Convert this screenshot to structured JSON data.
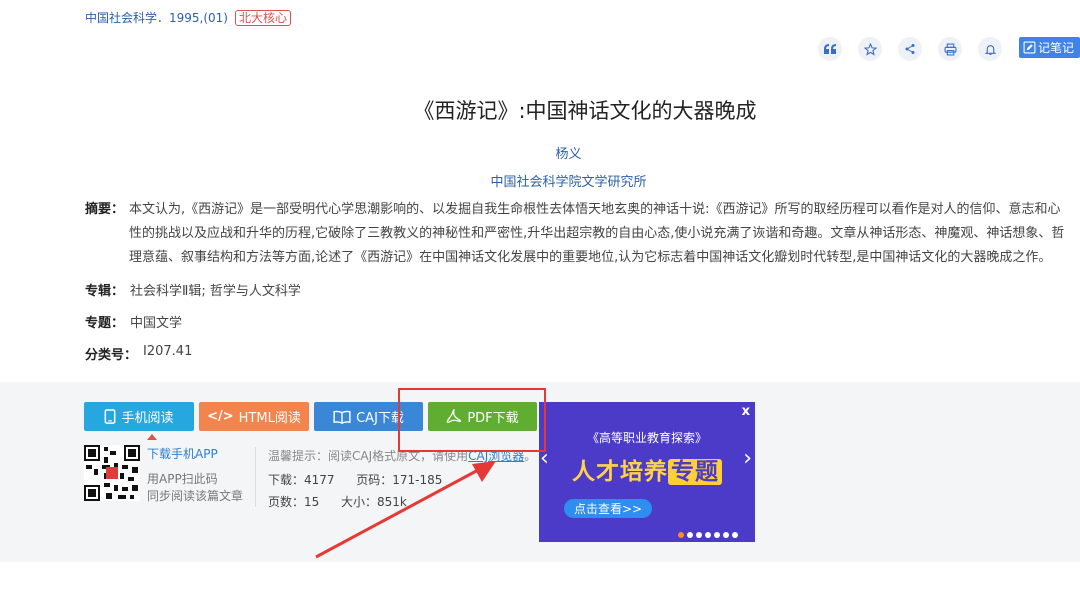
{
  "source": {
    "journal": "中国社会科学．1995,(01)",
    "badge": "北大核心"
  },
  "toolbar": {
    "icons": [
      "quote-icon",
      "star-icon",
      "share-icon",
      "print-icon",
      "bell-icon"
    ],
    "note_label": "记笔记"
  },
  "article": {
    "title": "《西游记》:中国神话文化的大器晚成",
    "author": "杨义",
    "organization": "中国社会科学院文学研究所",
    "abstract_label": "摘要：",
    "abstract_lines": [
      "本文认为,《西游记》是一部受明代心学思潮影响的、以发掘自我生命根性去体悟天地玄奥的神话十说:《西游记》所写的取经历程可以看作是对人的信仰、意志和心",
      "性的挑战以及应战和升华的历程,它破除了三教教义的神秘性和严密性,升华出超宗教的自由心态,使小说充满了诙谐和奇趣。文章从神话形态、神魔观、神话想象、哲",
      "理意蕴、叙事结构和方法等方面,论述了《西游记》在中国神话文化发展中的重要地位,认为它标志着中国神话文化瓣划时代转型,是中国神话文化的大器晚成之作。"
    ],
    "series_label": "专辑：",
    "series_value": "社会科学Ⅱ辑; 哲学与人文科学",
    "topic_label": "专题：",
    "topic_value": "中国文学",
    "class_label": "分类号：",
    "class_value": "I207.41"
  },
  "downloads": {
    "mobile": "手机阅读",
    "html": "HTML阅读",
    "caj": "CAJ下载",
    "pdf": "PDF下载",
    "app_download": "下载手机APP",
    "app_scan_line1": "用APP扫此码",
    "app_scan_line2": "同步阅读该篇文章",
    "tip_prefix": "温馨提示：阅读CAJ格式原文，请使用",
    "tip_link": "CAJ浏览器",
    "tip_suffix": "。",
    "downloads_label": "下载：",
    "downloads_value": "4177",
    "pages_label": "页码：",
    "pages_value": "171-185",
    "pagecount_label": "页数：",
    "pagecount_value": "15",
    "size_label": "大小：",
    "size_value": "851k"
  },
  "ad": {
    "close": "x",
    "tagline": "《高等职业教育探索》",
    "headline_a": "人才培养",
    "headline_b": "专题",
    "cta": "点击查看>>",
    "slides": 7,
    "active_slide": 0
  },
  "colors": {
    "annotation": "#e53935",
    "brand_blue": "#2b5fa8"
  }
}
